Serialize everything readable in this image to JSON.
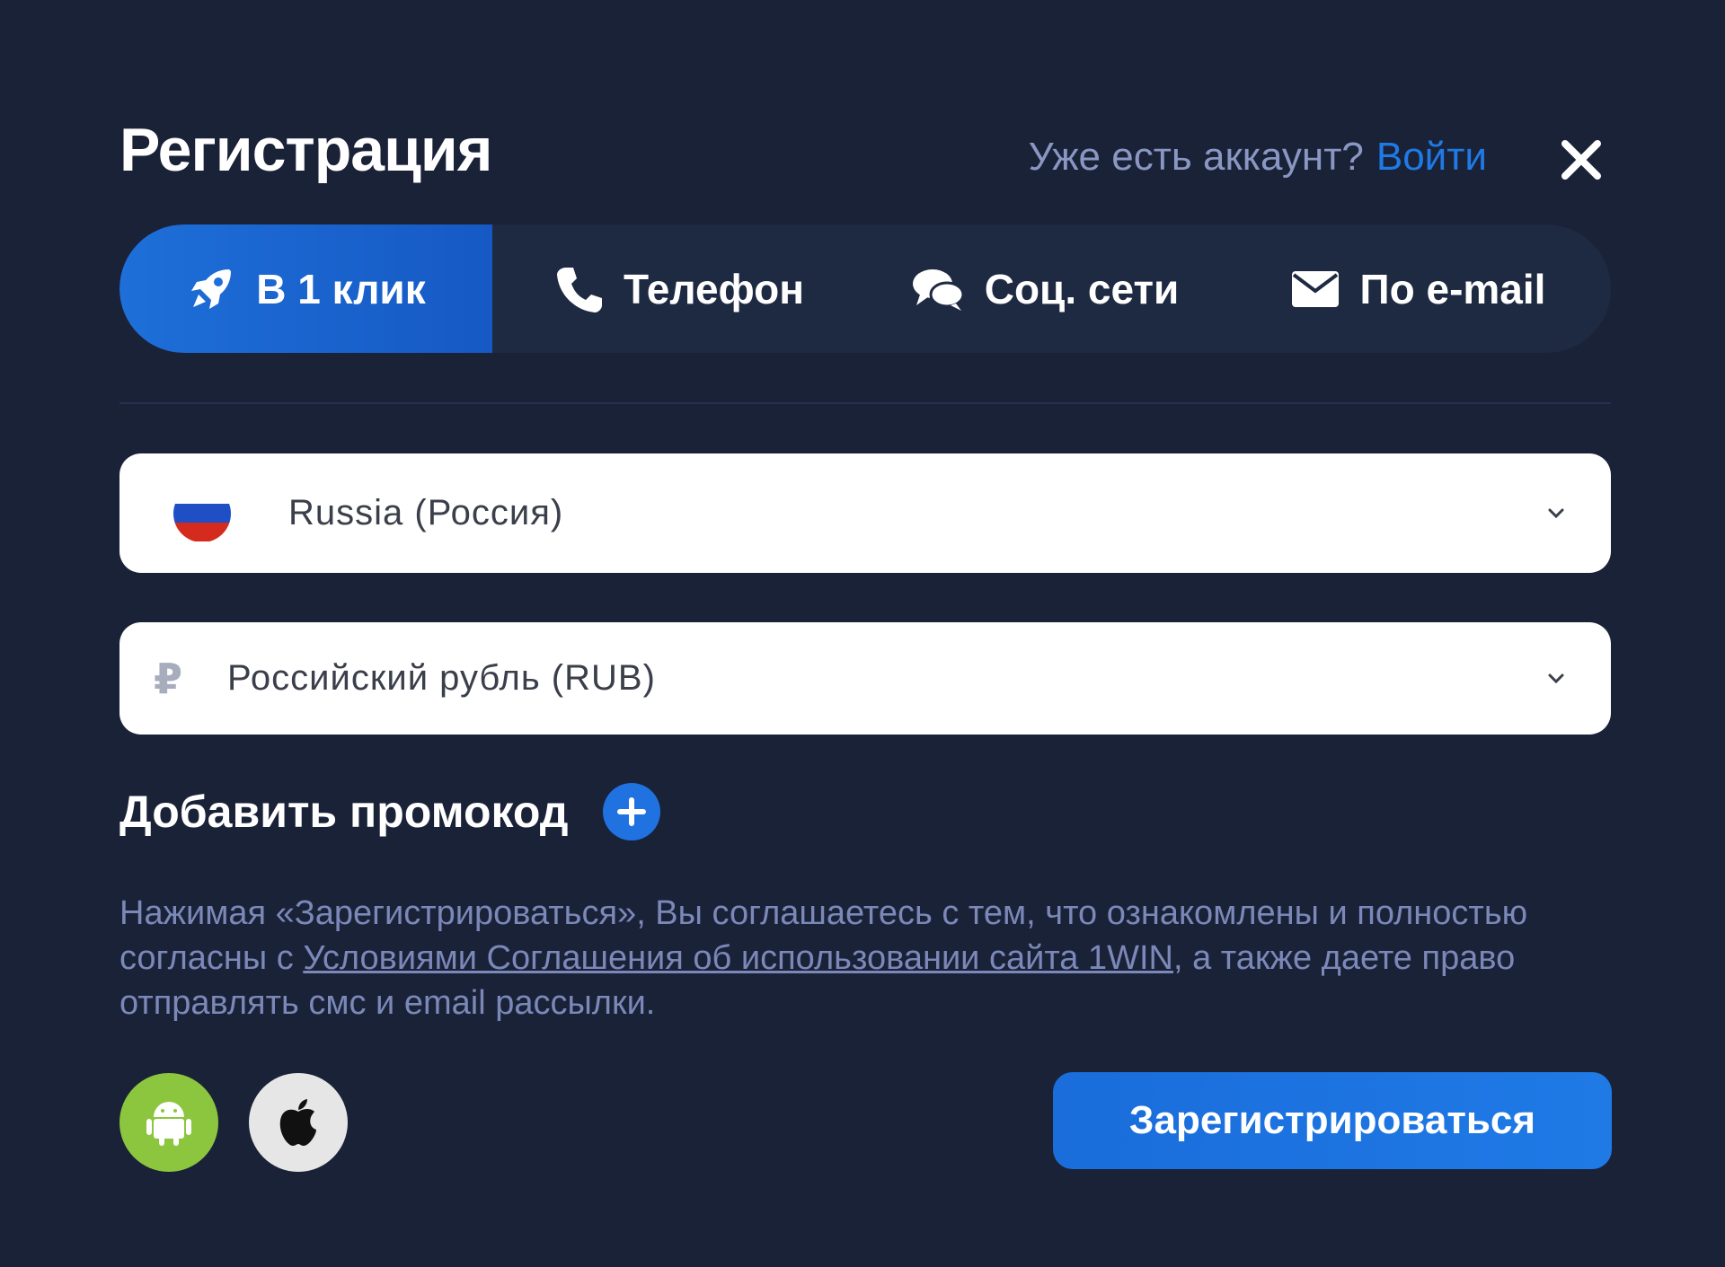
{
  "header": {
    "title": "Регистрация",
    "login_prompt": "Уже есть аккаунт?",
    "login_link": "Войти"
  },
  "tabs": [
    {
      "label": "В 1 клик",
      "icon": "rocket-icon",
      "active": true
    },
    {
      "label": "Телефон",
      "icon": "phone-icon",
      "active": false
    },
    {
      "label": "Соц. сети",
      "icon": "chat-icon",
      "active": false
    },
    {
      "label": "По e-mail",
      "icon": "envelope-icon",
      "active": false
    }
  ],
  "country_select": {
    "value": "Russia (Россия)",
    "flag": "russia-flag-icon"
  },
  "currency_select": {
    "symbol": "₽",
    "value": "Российский рубль (RUB)"
  },
  "promo": {
    "label": "Добавить промокод"
  },
  "legal": {
    "text_before": "Нажимая «Зарегистрироваться», Вы соглашаетесь с тем, что ознакомлены и полностью согласны с ",
    "link": "Условиями Соглашения об использовании сайта 1WIN",
    "text_after": ", а также даете право отправлять смс и email рассылки."
  },
  "apps": [
    {
      "name": "android",
      "icon": "android-icon"
    },
    {
      "name": "apple",
      "icon": "apple-icon"
    }
  ],
  "register_button": "Зарегистрироваться",
  "colors": {
    "background": "#1a2238",
    "accent": "#1f7ae6",
    "tab_bar": "#1e2942",
    "android_green": "#8cc63f",
    "muted_text": "#7b88b8"
  }
}
